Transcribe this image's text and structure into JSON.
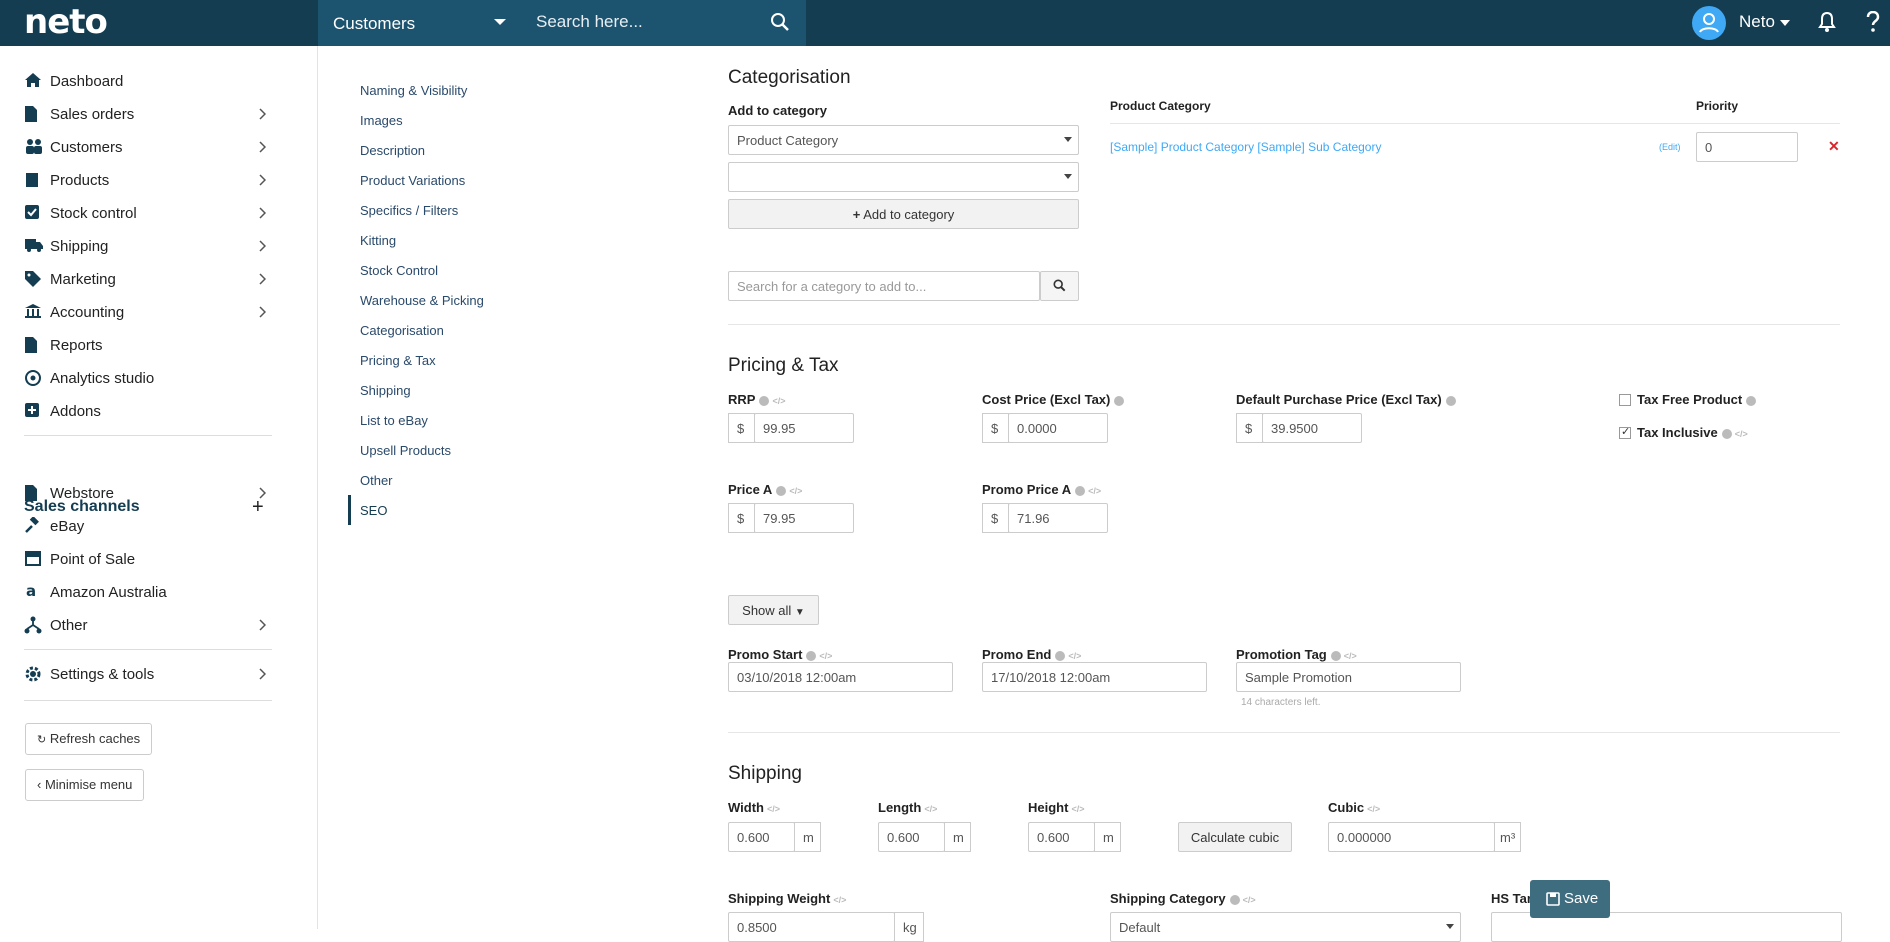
{
  "topbar": {
    "logo": "neto",
    "module_select": "Customers",
    "search_placeholder": "Search here...",
    "user_name": "Neto"
  },
  "sidebar": {
    "items": [
      {
        "label": "Dashboard",
        "icon": "home-icon"
      },
      {
        "label": "Sales orders",
        "icon": "document-icon"
      },
      {
        "label": "Customers",
        "icon": "users-icon"
      },
      {
        "label": "Products",
        "icon": "box-icon"
      },
      {
        "label": "Stock control",
        "icon": "checkbox-icon"
      },
      {
        "label": "Shipping",
        "icon": "truck-icon"
      },
      {
        "label": "Marketing",
        "icon": "tag-icon"
      },
      {
        "label": "Accounting",
        "icon": "bank-icon"
      },
      {
        "label": "Reports",
        "icon": "file-icon"
      },
      {
        "label": "Analytics studio",
        "icon": "analytics-icon"
      },
      {
        "label": "Addons",
        "icon": "plus-square-icon"
      }
    ],
    "sales_channels_heading": "Sales channels",
    "channels": [
      {
        "label": "Webstore",
        "icon": "file-icon"
      },
      {
        "label": "eBay",
        "icon": "gavel-icon"
      },
      {
        "label": "Point of Sale",
        "icon": "store-icon"
      },
      {
        "label": "Amazon Australia",
        "icon": "amazon-icon"
      },
      {
        "label": "Other",
        "icon": "network-icon"
      }
    ],
    "settings": "Settings & tools",
    "refresh_caches": "Refresh caches",
    "minimise_menu": "Minimise menu"
  },
  "subnav": {
    "items": [
      "Naming & Visibility",
      "Images",
      "Description",
      "Product Variations",
      "Specifics / Filters",
      "Kitting",
      "Stock Control",
      "Warehouse & Picking",
      "Categorisation",
      "Pricing & Tax",
      "Shipping",
      "List to eBay",
      "Upsell Products",
      "Other",
      "SEO"
    ]
  },
  "categorisation": {
    "title": "Categorisation",
    "add_to_category_label": "Add to category",
    "category_select": "Product Category",
    "sub_select": "",
    "add_button": "Add to category",
    "search_placeholder": "Search for a category to add to...",
    "table_header_category": "Product Category",
    "table_header_priority": "Priority",
    "row_category": "[Sample] Product Category [Sample] Sub Category",
    "row_edit": "(Edit)",
    "row_priority": "0"
  },
  "pricing": {
    "title": "Pricing & Tax",
    "rrp_label": "RRP",
    "rrp_value": "99.95",
    "cost_label": "Cost Price (Excl Tax)",
    "cost_value": "0.0000",
    "default_purchase_label": "Default Purchase Price (Excl Tax)",
    "default_purchase_value": "39.9500",
    "tax_free_label": "Tax Free Product",
    "tax_inclusive_label": "Tax Inclusive",
    "price_a_label": "Price A",
    "price_a_value": "79.95",
    "promo_price_a_label": "Promo Price A",
    "promo_price_a_value": "71.96",
    "currency": "$",
    "show_all": "Show all",
    "promo_start_label": "Promo Start",
    "promo_start_value": "03/10/2018 12:00am",
    "promo_end_label": "Promo End",
    "promo_end_value": "17/10/2018 12:00am",
    "promo_tag_label": "Promotion Tag",
    "promo_tag_value": "Sample Promotion",
    "promo_tag_hint": "14 characters left."
  },
  "shipping": {
    "title": "Shipping",
    "width_label": "Width",
    "width_value": "0.600",
    "length_label": "Length",
    "length_value": "0.600",
    "height_label": "Height",
    "height_value": "0.600",
    "unit_m": "m",
    "calculate_cubic": "Calculate cubic",
    "cubic_label": "Cubic",
    "cubic_value": "0.000000",
    "unit_m3": "m³",
    "weight_label": "Shipping Weight",
    "weight_value": "0.8500",
    "unit_kg": "kg",
    "category_label": "Shipping Category",
    "category_value": "Default",
    "hs_label": "HS Tariff"
  },
  "save_button": "Save"
}
